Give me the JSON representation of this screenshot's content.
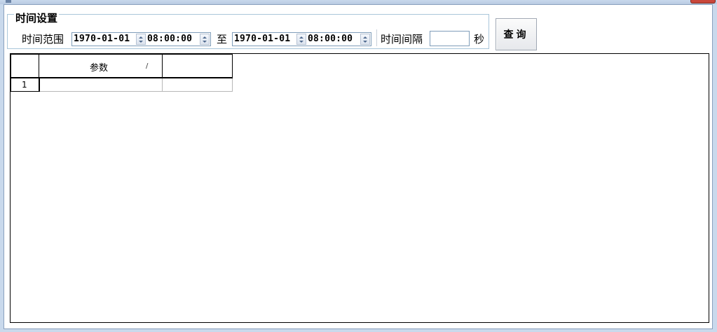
{
  "group": {
    "title": "时间设置"
  },
  "time_range": {
    "label": "时间范围",
    "start_date": "1970-01-01",
    "start_time": "08:00:00",
    "to_label": "至",
    "end_date": "1970-01-01",
    "end_time": "08:00:00"
  },
  "interval": {
    "label": "时间间隔",
    "value": "",
    "unit": "秒"
  },
  "query_button": {
    "label": "查询"
  },
  "grid": {
    "columns": [
      "",
      "参数",
      ""
    ],
    "sort_indicator": "/",
    "rows": [
      {
        "num": "1",
        "param": "",
        "extra": ""
      }
    ]
  }
}
